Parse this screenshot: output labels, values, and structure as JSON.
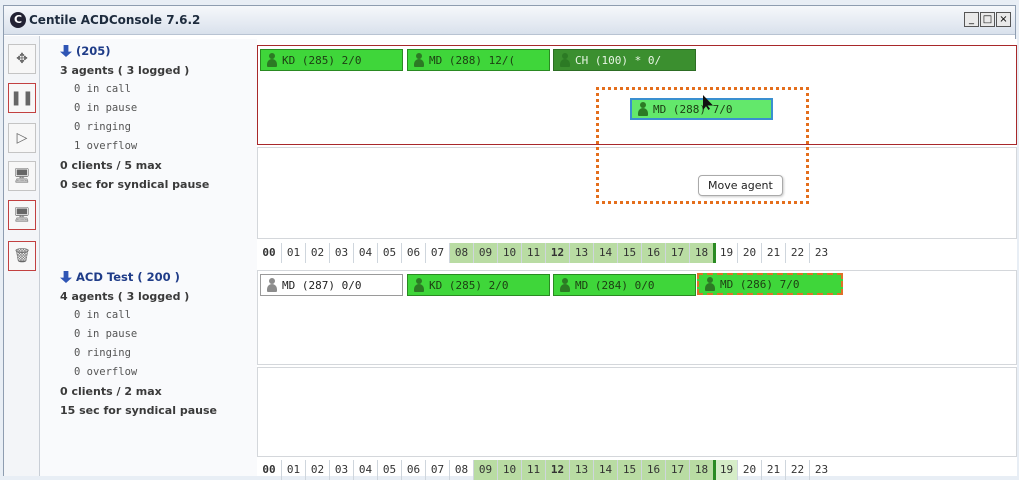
{
  "window": {
    "title": "Centile ACDConsole 7.6.2",
    "logo_letter": "C",
    "buttons": [
      "_",
      "□",
      "×"
    ]
  },
  "toolbar": {
    "icons": [
      "move-icon",
      "pause-icon",
      "play-icon",
      "monitor-icon",
      "monitor-remove-icon",
      "trash-icon"
    ]
  },
  "groups": [
    {
      "name": "(205)",
      "agents_line": "3 agents ( 3 logged )",
      "stats": [
        "0 in call",
        "0 in pause",
        "0 ringing",
        "1 overflow"
      ],
      "clients_line": "0 clients / 5 max",
      "pause_line": "0 sec for syndical pause",
      "agents": [
        {
          "label": "KD (285)  2/0",
          "style": "green"
        },
        {
          "label": "MD (288)  12/(",
          "style": "green"
        },
        {
          "label": "CH (100) *  0/",
          "style": "dark"
        }
      ],
      "dragged_agent": "MD (288)  7/0"
    },
    {
      "name": "ACD Test ( 200 )",
      "agents_line": "4 agents ( 3 logged )",
      "stats": [
        "0 in call",
        "0 in pause",
        "0 ringing",
        "0 overflow"
      ],
      "clients_line": "0 clients / 2 max",
      "pause_line": "15 sec for syndical pause",
      "agents": [
        {
          "label": "MD (287)  0/0",
          "style": "white"
        },
        {
          "label": "KD (285)  2/0",
          "style": "green"
        },
        {
          "label": "MD (284)  0/0",
          "style": "green"
        },
        {
          "label": "MD (286)  7/0",
          "style": "selected"
        }
      ]
    }
  ],
  "hours": [
    "00",
    "01",
    "02",
    "03",
    "04",
    "05",
    "06",
    "07",
    "08",
    "09",
    "10",
    "11",
    "12",
    "13",
    "14",
    "15",
    "16",
    "17",
    "18",
    "19",
    "20",
    "21",
    "22",
    "23"
  ],
  "tooltip": "Move agent"
}
